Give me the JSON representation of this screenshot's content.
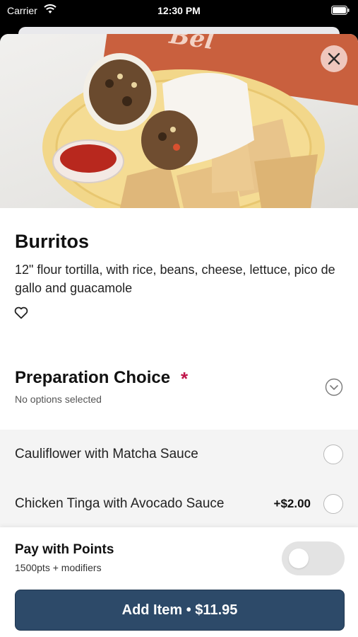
{
  "status_bar": {
    "carrier": "Carrier",
    "time": "12:30 PM"
  },
  "hero": {
    "banner_text": "Bel",
    "image_icon": "burrito-plate-photo"
  },
  "item": {
    "title": "Burritos",
    "description": "12\" flour tortilla, with rice, beans, cheese, lettuce, pico de gallo and guacamole"
  },
  "preparation": {
    "title": "Preparation Choice",
    "required_mark": "*",
    "subtitle": "No options selected",
    "options": [
      {
        "label": "Cauliflower with Matcha Sauce",
        "price": ""
      },
      {
        "label": "Chicken Tinga with Avocado Sauce",
        "price": "+$2.00"
      }
    ]
  },
  "points": {
    "title": "Pay with Points",
    "subtitle": "1500pts + modifiers",
    "enabled": false
  },
  "cta": {
    "label": "Add Item • $11.95"
  },
  "colors": {
    "accent": "#2d4a69",
    "required": "#c0154a",
    "banner": "#c9603e"
  }
}
